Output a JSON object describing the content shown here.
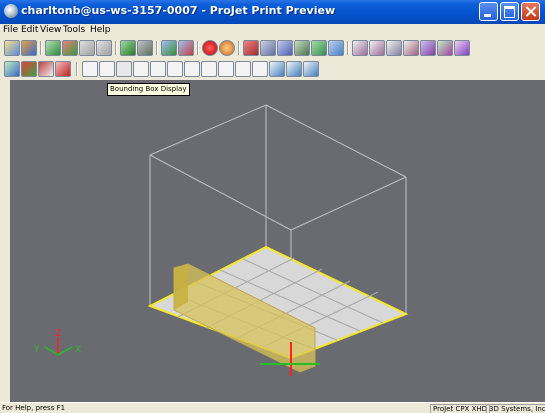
{
  "window": {
    "title": "charltonb@us-ws-3157-0007 - ProJet Print Preview"
  },
  "menu": {
    "items": [
      "File",
      "Edit",
      "View",
      "Tools",
      "Help"
    ]
  },
  "toolbar1": {
    "icons": [
      "open-file-icon",
      "import-icon",
      "tray-icon",
      "rotate-icon",
      "arrange-icon",
      "arrange2-icon",
      "duplicate-icon",
      "duplicate2-icon",
      "zoom-icon",
      "zoom-fit-icon",
      "stop-icon",
      "record-icon",
      "cut-icon",
      "grid-icon",
      "stack-icon",
      "layers-icon",
      "paint-icon",
      "pack-icon",
      "measure-icon",
      "pencil-icon",
      "pencil2-icon",
      "wand-icon",
      "refresh-icon",
      "transform-icon",
      "undo-icon"
    ]
  },
  "toolbar2": {
    "icons": [
      "view-icon",
      "color-icon",
      "texture-icon",
      "gear-icon",
      "bounding-box-icon",
      "box-icon",
      "solid-icon",
      "diamond-icon",
      "front-view-icon",
      "back-view-icon",
      "left-view-icon",
      "right-view-icon",
      "top-view-icon",
      "bottom-view-icon",
      "iso-view-icon",
      "zoom-in-icon",
      "zoom-out-icon",
      "zoom-all-icon"
    ]
  },
  "tooltip": {
    "text": "Bounding Box Display"
  },
  "axes": {
    "z": "Z",
    "y": "Y",
    "x": "X"
  },
  "status": {
    "help": "For Help, press F1",
    "printer": "ProJet CPX XHD",
    "vendor": "3D Systems, Inc."
  },
  "colors": {
    "viewport": "#696b70",
    "tray": "#d8d8d8",
    "tray_edge": "#f4e82a",
    "part": "#d8c35a",
    "box": "#c0c0c0"
  }
}
